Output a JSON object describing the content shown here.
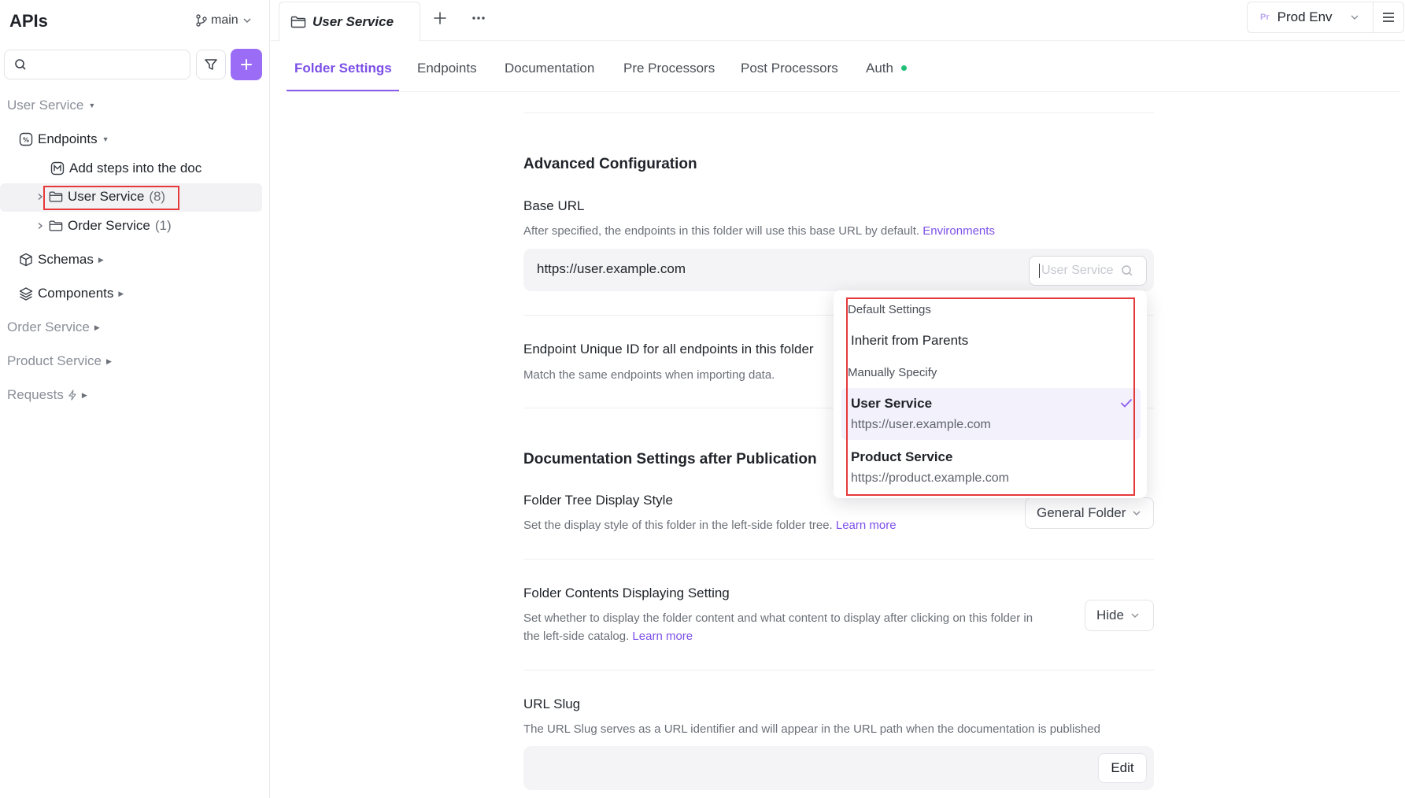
{
  "sidebar": {
    "title": "APIs",
    "branch": "main",
    "search_placeholder": "",
    "tree": {
      "user_service_group": "User Service",
      "endpoints": "Endpoints",
      "add_steps_doc": "Add steps into the doc",
      "user_service_folder": "User Service",
      "user_service_count": "(8)",
      "order_service_folder": "Order Service",
      "order_service_count": "(1)",
      "schemas": "Schemas",
      "components": "Components",
      "order_service_group": "Order Service",
      "product_service_group": "Product Service",
      "requests_group": "Requests"
    }
  },
  "topbar": {
    "active_tab": "User Service",
    "env_badge": "Pr",
    "env_label": "Prod Env"
  },
  "section_tabs": [
    {
      "label": "Folder Settings",
      "active": true
    },
    {
      "label": "Endpoints"
    },
    {
      "label": "Documentation"
    },
    {
      "label": "Pre Processors"
    },
    {
      "label": "Post Processors"
    },
    {
      "label": "Auth"
    }
  ],
  "main": {
    "advanced_title": "Advanced Configuration",
    "base_url_label": "Base URL",
    "base_url_desc": "After specified, the endpoints in this folder will use this base URL by default.",
    "base_url_link": "Environments",
    "base_url_value": "https://user.example.com",
    "service_search_placeholder": "User Service",
    "unique_id_label": "Endpoint Unique ID for all endpoints in this folder",
    "unique_id_desc": "Match the same endpoints when importing data.",
    "doc_title": "Documentation Settings after Publication",
    "tree_style_label": "Folder Tree Display Style",
    "tree_style_desc": "Set the display style of this folder in the left-side folder tree.",
    "tree_style_link": "Learn more",
    "tree_style_value": "General Folder",
    "contents_label": "Folder Contents Displaying Setting",
    "contents_desc_1": "Set whether to display the folder content and what content to display after clicking on this folder in",
    "contents_desc_2": "the left-side catalog.",
    "contents_link": "Learn more",
    "contents_value": "Hide",
    "slug_label": "URL Slug",
    "slug_desc": "The URL Slug serves as a URL identifier and will appear in the URL path when the documentation is published",
    "slug_edit": "Edit"
  },
  "dropdown": {
    "group_default": "Default Settings",
    "inherit": "Inherit from Parents",
    "group_manual": "Manually Specify",
    "options": [
      {
        "name": "User Service",
        "url": "https://user.example.com",
        "selected": true
      },
      {
        "name": "Product Service",
        "url": "https://product.example.com",
        "selected": false
      }
    ]
  },
  "colors": {
    "accent": "#7b4fe8",
    "add_button": "#9b6cf5",
    "auth_dot": "#1fbf75",
    "highlight_box": "#e6393a"
  }
}
